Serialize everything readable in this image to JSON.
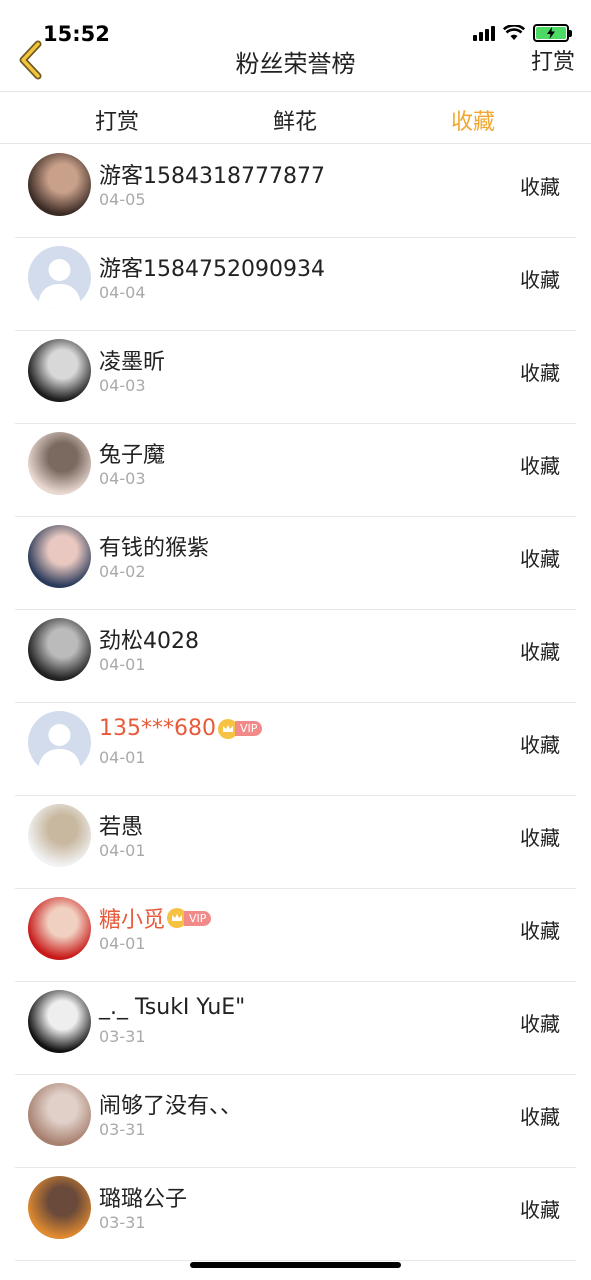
{
  "status": {
    "time": "15:52"
  },
  "nav": {
    "title": "粉丝荣誉榜",
    "action": "打赏"
  },
  "tabs": [
    {
      "label": "打赏"
    },
    {
      "label": "鲜花"
    },
    {
      "label": "收藏"
    }
  ],
  "colors": {
    "accent": "#f0a830",
    "vip_name": "#e85a3c",
    "date": "#aaaaaa"
  },
  "rows": [
    {
      "name": "游客1584318777877",
      "date": "04-05",
      "type": "收藏",
      "vip": false,
      "avatar": "photo"
    },
    {
      "name": "游客1584752090934",
      "date": "04-04",
      "type": "收藏",
      "vip": false,
      "avatar": "default"
    },
    {
      "name": "凌墨昕",
      "date": "04-03",
      "type": "收藏",
      "vip": false,
      "avatar": "photo"
    },
    {
      "name": "兔子魔",
      "date": "04-03",
      "type": "收藏",
      "vip": false,
      "avatar": "photo"
    },
    {
      "name": "有钱的猴紫",
      "date": "04-02",
      "type": "收藏",
      "vip": false,
      "avatar": "photo"
    },
    {
      "name": "劲松4028",
      "date": "04-01",
      "type": "收藏",
      "vip": false,
      "avatar": "photo"
    },
    {
      "name": "135***680",
      "date": "04-01",
      "type": "收藏",
      "vip": true,
      "vip_label": "VIP",
      "avatar": "default"
    },
    {
      "name": "若愚",
      "date": "04-01",
      "type": "收藏",
      "vip": false,
      "avatar": "photo"
    },
    {
      "name": "糖小觅",
      "date": "04-01",
      "type": "收藏",
      "vip": true,
      "vip_label": "VIP",
      "avatar": "photo"
    },
    {
      "name": "_._ TsukI YuE\"",
      "date": "03-31",
      "type": "收藏",
      "vip": false,
      "avatar": "photo"
    },
    {
      "name": "闹够了没有、、",
      "date": "03-31",
      "type": "收藏",
      "vip": false,
      "avatar": "photo"
    },
    {
      "name": "璐璐公子",
      "date": "03-31",
      "type": "收藏",
      "vip": false,
      "avatar": "photo"
    }
  ]
}
